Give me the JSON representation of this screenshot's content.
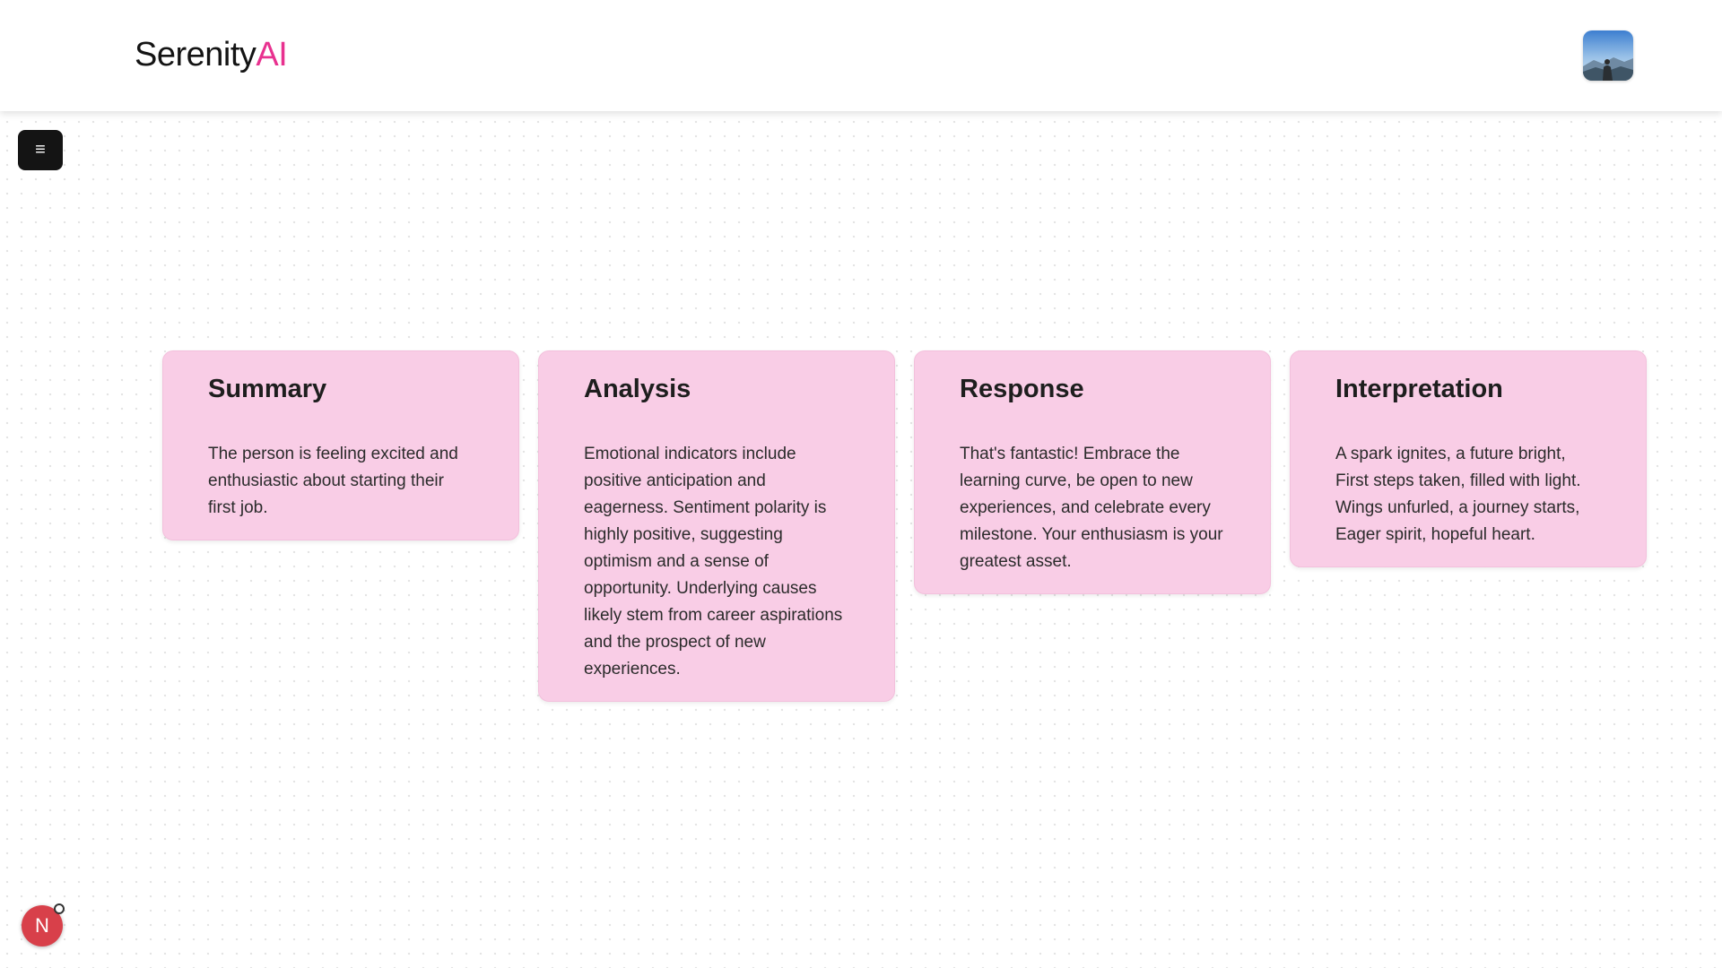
{
  "header": {
    "brand_main": "Serenity",
    "brand_accent": "AI",
    "avatar_icon": "profile-photo-icon"
  },
  "menu": {
    "icon_glyph": "≡",
    "icon": "hamburger-menu-icon"
  },
  "cards": [
    {
      "title": "Summary",
      "body": "The person is feeling excited and enthusiastic about starting their first job."
    },
    {
      "title": "Analysis",
      "body": "Emotional indicators include positive anticipation and eagerness. Sentiment polarity is highly positive, suggesting optimism and a sense of opportunity. Underlying causes likely stem from career aspirations and the prospect of new experiences."
    },
    {
      "title": "Response",
      "body": "That's fantastic! Embrace the learning curve, be open to new experiences, and celebrate every milestone. Your enthusiasm is your greatest asset."
    },
    {
      "title": "Interpretation",
      "body": "A spark ignites, a future bright, First steps taken, filled with light. Wings unfurled, a journey starts, Eager spirit, hopeful heart."
    }
  ],
  "notification": {
    "letter": "N"
  },
  "colors": {
    "brand_accent": "#e8318f",
    "card_background": "#f9cde6",
    "menu_button": "#141414",
    "notification": "#d8404a"
  }
}
